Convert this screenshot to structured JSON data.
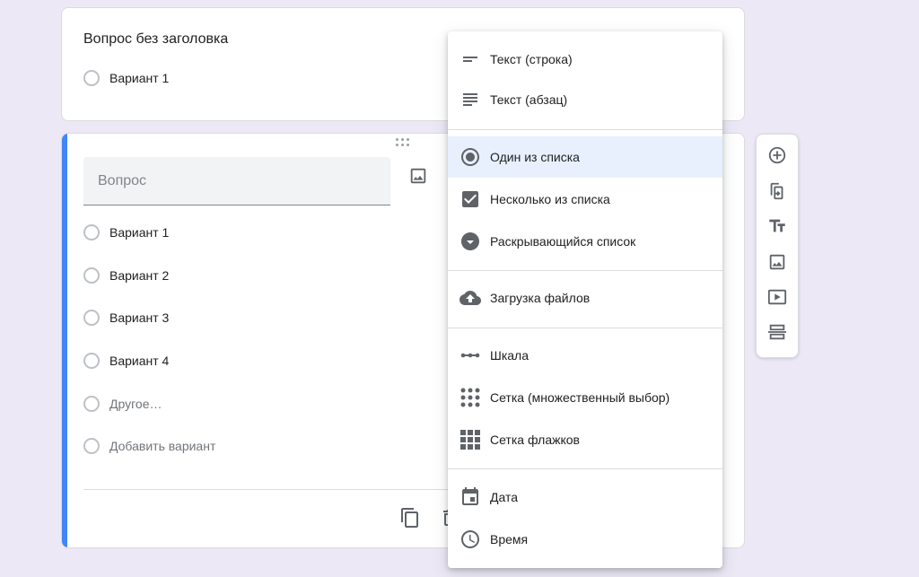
{
  "card1": {
    "title": "Вопрос без заголовка",
    "options": [
      "Вариант 1"
    ]
  },
  "card2": {
    "question_placeholder": "Вопрос",
    "options": [
      "Вариант 1",
      "Вариант 2",
      "Вариант 3",
      "Вариант 4"
    ],
    "other_label": "Другое…",
    "add_option_label": "Добавить вариант"
  },
  "dropdown": {
    "items": [
      {
        "label": "Текст (строка)",
        "icon": "short-text-icon"
      },
      {
        "label": "Текст (абзац)",
        "icon": "paragraph-icon"
      },
      {
        "label": "Один из списка",
        "icon": "radio-button-icon",
        "selected": true
      },
      {
        "label": "Несколько из списка",
        "icon": "checkbox-icon"
      },
      {
        "label": "Раскрывающийся список",
        "icon": "dropdown-arrow-icon"
      },
      {
        "label": "Загрузка файлов",
        "icon": "cloud-upload-icon"
      },
      {
        "label": "Шкала",
        "icon": "linear-scale-icon"
      },
      {
        "label": "Сетка (множественный выбор)",
        "icon": "radio-grid-icon"
      },
      {
        "label": "Сетка флажков",
        "icon": "checkbox-grid-icon"
      },
      {
        "label": "Дата",
        "icon": "calendar-icon"
      },
      {
        "label": "Время",
        "icon": "clock-icon"
      }
    ]
  },
  "sidebar": {
    "buttons": [
      "add-question-icon",
      "import-questions-icon",
      "add-title-icon",
      "add-image-icon",
      "add-video-icon",
      "add-section-icon"
    ]
  },
  "colors": {
    "accent": "#4285f4",
    "icon": "#5f6368",
    "selected_bg": "#e8f0fe",
    "background": "#ece8f6"
  }
}
